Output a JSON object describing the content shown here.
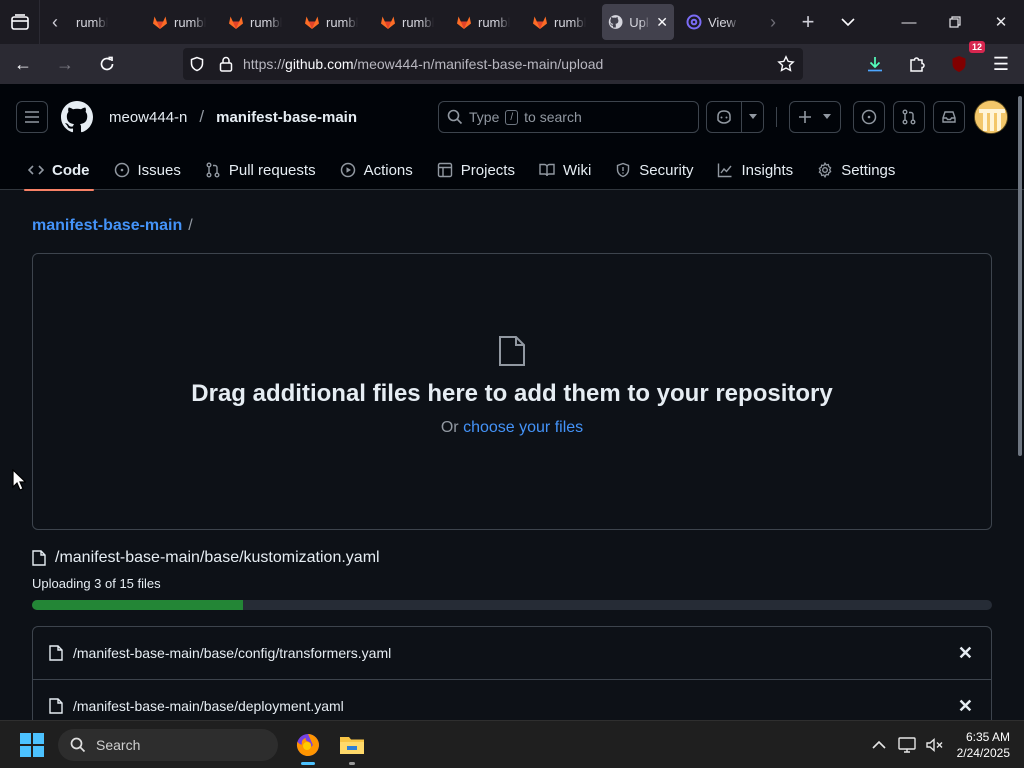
{
  "browser": {
    "tabs": [
      {
        "label": "rumble",
        "icon": "rumble-icon"
      },
      {
        "label": "rumble",
        "icon": "gitlab-fox-icon"
      },
      {
        "label": "rumble",
        "icon": "gitlab-fox-icon"
      },
      {
        "label": "rumble",
        "icon": "gitlab-fox-icon"
      },
      {
        "label": "rumble",
        "icon": "gitlab-fox-icon"
      },
      {
        "label": "rumble",
        "icon": "gitlab-fox-icon"
      },
      {
        "label": "rumble",
        "icon": "gitlab-fox-icon"
      },
      {
        "label": "Upload",
        "icon": "github-icon",
        "active": true
      },
      {
        "label": "View r",
        "icon": "at-sign-icon"
      }
    ],
    "url": {
      "prefix": "https://",
      "host": "github.com",
      "path": "/meow444-n/manifest-base-main/upload"
    },
    "extension_badge": "12"
  },
  "github": {
    "owner": "meow444-n",
    "repo": "manifest-base-main",
    "search": {
      "prefix": "Type",
      "key": "/",
      "suffix": "to search"
    },
    "repo_tabs": [
      {
        "label": "Code",
        "icon": "code-icon",
        "selected": true
      },
      {
        "label": "Issues",
        "icon": "issue-icon"
      },
      {
        "label": "Pull requests",
        "icon": "pull-request-icon"
      },
      {
        "label": "Actions",
        "icon": "actions-play-icon"
      },
      {
        "label": "Projects",
        "icon": "projects-table-icon"
      },
      {
        "label": "Wiki",
        "icon": "book-icon"
      },
      {
        "label": "Security",
        "icon": "shield-icon"
      },
      {
        "label": "Insights",
        "icon": "graph-icon"
      },
      {
        "label": "Settings",
        "icon": "gear-icon"
      }
    ]
  },
  "upload": {
    "breadcrumb_repo": "manifest-base-main",
    "breadcrumb_sep": "/",
    "dropzone_title": "Drag additional files here to add them to your repository",
    "dropzone_or": "Or",
    "dropzone_link": "choose your files",
    "current_file": "/manifest-base-main/base/kustomization.yaml",
    "status": "Uploading 3 of 15 files",
    "progress_fraction": 0.22,
    "progress_color": "#238636",
    "files": [
      "/manifest-base-main/base/config/transformers.yaml",
      "/manifest-base-main/base/deployment.yaml"
    ],
    "remove_glyph": "✕"
  },
  "taskbar": {
    "search_placeholder": "Search",
    "time": "6:35 AM",
    "date": "2/24/2025"
  },
  "colors": {
    "link": "#4493f8",
    "tab_underline": "#f78166",
    "background": "#0d1117"
  }
}
